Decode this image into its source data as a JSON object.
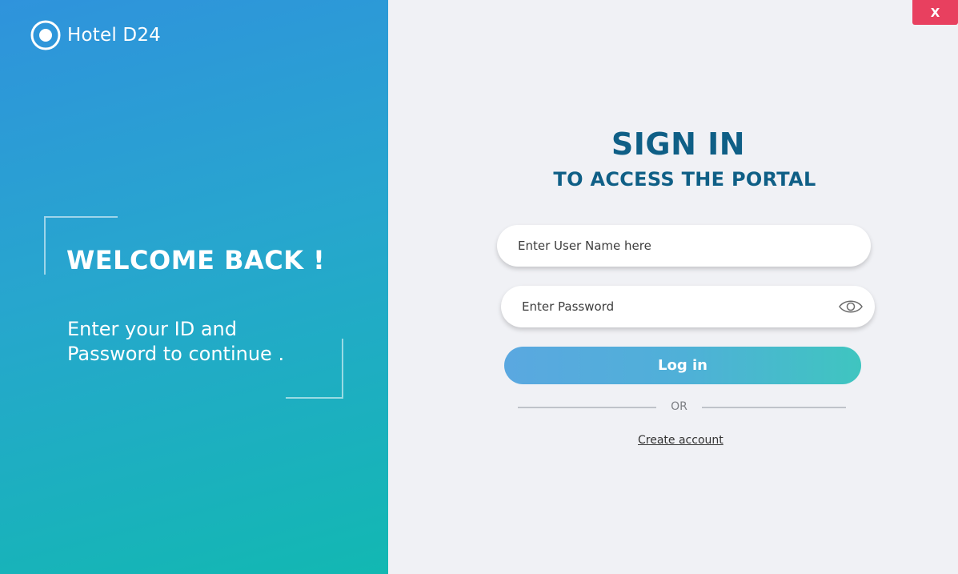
{
  "brand": {
    "name": "Hotel D24"
  },
  "welcome": {
    "title": "WELCOME BACK !",
    "line1": "Enter your ID and",
    "line2": "Password to continue ."
  },
  "window": {
    "close_label": "X"
  },
  "signin": {
    "title": "SIGN IN",
    "subtitle": "TO ACCESS THE PORTAL"
  },
  "form": {
    "username_placeholder": "Enter User Name here",
    "username_value": "",
    "password_placeholder": "Enter Password",
    "password_value": "",
    "login_label": "Log in",
    "or_label": "OR",
    "create_account_label": "Create account"
  },
  "colors": {
    "accent_dark": "#0f5f86",
    "close_red": "#e8405f",
    "gradient_start": "#2f93dc",
    "gradient_end": "#12b8b2"
  },
  "icons": {
    "logo": "radio-circle-icon",
    "password_toggle": "eye-icon"
  }
}
